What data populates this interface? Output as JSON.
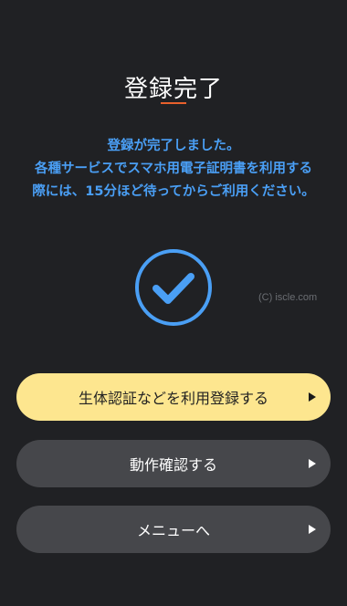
{
  "header": {
    "title": "登録完了"
  },
  "message": {
    "line1": "登録が完了しました。",
    "line2": "各種サービスでスマホ用電子証明書を利用する",
    "line3": "際には、15分ほど待ってからご利用ください。"
  },
  "status_icon": "check-circle-icon",
  "watermark": "(C) iscle.com",
  "buttons": {
    "biometric": {
      "label": "生体認証などを利用登録する",
      "icon": "play-arrow-icon"
    },
    "verify": {
      "label": "動作確認する",
      "icon": "play-arrow-icon"
    },
    "menu": {
      "label": "メニューへ",
      "icon": "play-arrow-icon"
    }
  },
  "colors": {
    "background": "#202124",
    "accent_underline": "#e8602c",
    "message_text": "#4a9ff5",
    "primary_button": "#fde68f",
    "secondary_button": "#46474b"
  }
}
